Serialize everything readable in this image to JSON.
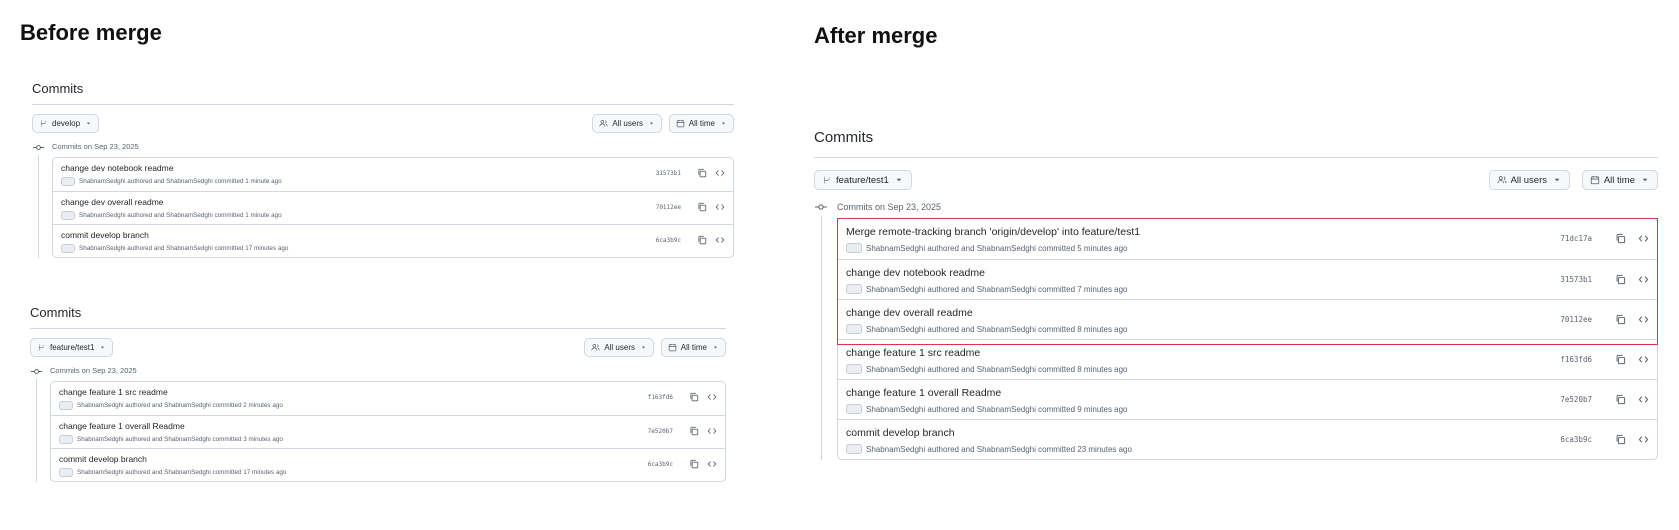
{
  "before": {
    "heading": "Before merge",
    "panels": [
      {
        "title": "Commits",
        "branch": "develop",
        "users_filter": "All users",
        "time_filter": "All time",
        "date_label": "Commits on Sep 23, 2025",
        "commits": [
          {
            "message": "change dev notebook readme",
            "meta": "ShabnamSedghi authored and ShabnamSedghi committed 1 minute ago",
            "sha": "31573b1"
          },
          {
            "message": "change dev overall readme",
            "meta": "ShabnamSedghi authored and ShabnamSedghi committed 1 minute ago",
            "sha": "70112ee"
          },
          {
            "message": "commit develop branch",
            "meta": "ShabnamSedghi authored and ShabnamSedghi committed 17 minutes ago",
            "sha": "6ca3b9c"
          }
        ]
      },
      {
        "title": "Commits",
        "branch": "feature/test1",
        "users_filter": "All users",
        "time_filter": "All time",
        "date_label": "Commits on Sep 23, 2025",
        "commits": [
          {
            "message": "change feature 1 src readme",
            "meta": "ShabnamSedghi authored and ShabnamSedghi committed 2 minutes ago",
            "sha": "f163fd6"
          },
          {
            "message": "change feature 1 overall Readme",
            "meta": "ShabnamSedghi authored and ShabnamSedghi committed 3 minutes ago",
            "sha": "7e520b7"
          },
          {
            "message": "commit develop branch",
            "meta": "ShabnamSedghi authored and ShabnamSedghi committed 17 minutes ago",
            "sha": "6ca3b9c"
          }
        ]
      }
    ]
  },
  "after": {
    "heading": "After merge",
    "panel": {
      "title": "Commits",
      "branch": "feature/test1",
      "users_filter": "All users",
      "time_filter": "All time",
      "date_label": "Commits on Sep 23, 2025",
      "commits": [
        {
          "message": "Merge remote-tracking branch 'origin/develop' into feature/test1",
          "meta": "ShabnamSedghi authored and ShabnamSedghi committed 5 minutes ago",
          "sha": "71dc17a"
        },
        {
          "message": "change dev notebook readme",
          "meta": "ShabnamSedghi authored and ShabnamSedghi committed 7 minutes ago",
          "sha": "31573b1"
        },
        {
          "message": "change dev overall readme",
          "meta": "ShabnamSedghi authored and ShabnamSedghi committed 8 minutes ago",
          "sha": "70112ee"
        },
        {
          "message": "change feature 1 src readme",
          "meta": "ShabnamSedghi authored and ShabnamSedghi committed 8 minutes ago",
          "sha": "f163fd6"
        },
        {
          "message": "change feature 1 overall Readme",
          "meta": "ShabnamSedghi authored and ShabnamSedghi committed 9 minutes ago",
          "sha": "7e520b7"
        },
        {
          "message": "commit develop branch",
          "meta": "ShabnamSedghi authored and ShabnamSedghi committed 23 minutes ago",
          "sha": "6ca3b9c"
        }
      ]
    },
    "highlight_color": "#d9364d"
  },
  "icons": {
    "branch": "git-branch-icon",
    "users": "people-icon",
    "time": "calendar-icon",
    "caret": "triangle-down-icon",
    "commit": "git-commit-icon",
    "copy": "copy-icon",
    "browse": "code-icon"
  }
}
